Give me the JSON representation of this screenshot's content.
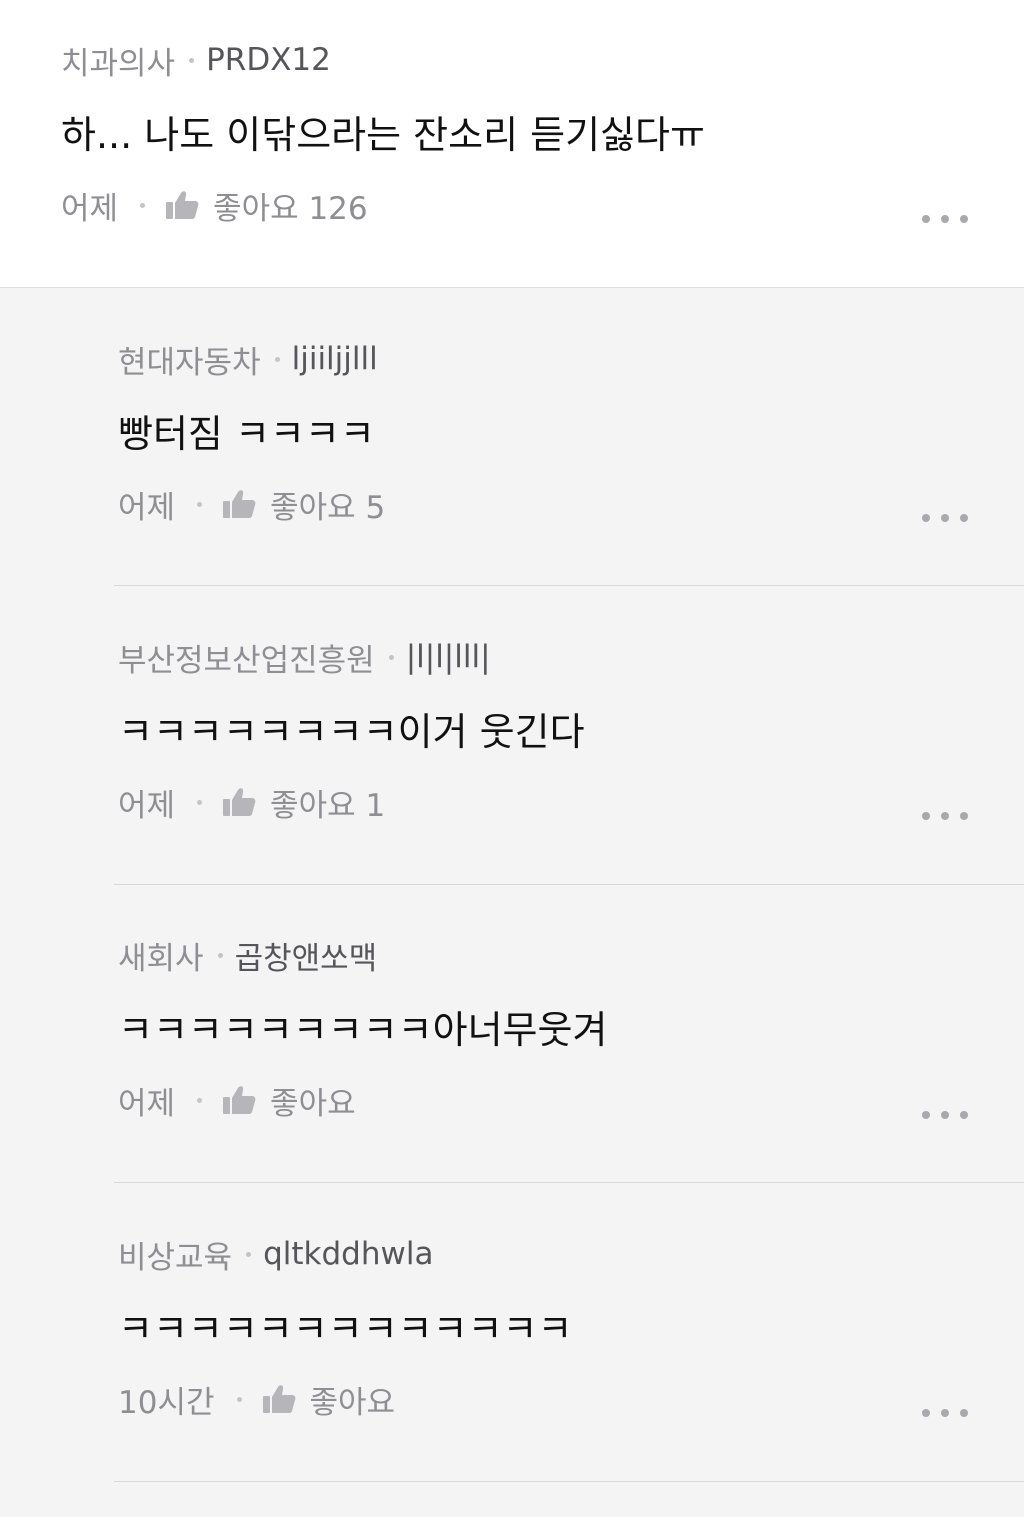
{
  "comments": [
    {
      "company": "치과의사",
      "nickname": "PRDX12",
      "text": "하... 나도 이닦으라는 잔소리 듣기싫다ㅠ",
      "time": "어제",
      "like_label": "좋아요 126"
    },
    {
      "company": "현대자동차",
      "nickname": "ljiiljjlll",
      "text": "빵터짐 ㅋㅋㅋㅋ",
      "time": "어제",
      "like_label": "좋아요 5"
    },
    {
      "company": "부산정보산업진흥원",
      "nickname": "|l|l|lll|",
      "text": "ㅋㅋㅋㅋㅋㅋㅋㅋ이거 웃긴다",
      "time": "어제",
      "like_label": "좋아요 1"
    },
    {
      "company": "새회사",
      "nickname": "곱창앤쏘맥",
      "text": "ㅋㅋㅋㅋㅋㅋㅋㅋㅋ아너무웃겨",
      "time": "어제",
      "like_label": "좋아요"
    },
    {
      "company": "비상교육",
      "nickname": "qltkddhwla",
      "text": "ㅋㅋㅋㅋㅋㅋㅋㅋㅋㅋㅋㅋㅋ",
      "time": "10시간",
      "like_label": "좋아요"
    }
  ],
  "icons": {
    "like": "thumbs-up-icon",
    "more": "more-horizontal-icon"
  },
  "colors": {
    "background": "#f4f4f5",
    "top_background": "#ffffff",
    "meta_text": "#8e8e93",
    "body_text": "#111111"
  }
}
